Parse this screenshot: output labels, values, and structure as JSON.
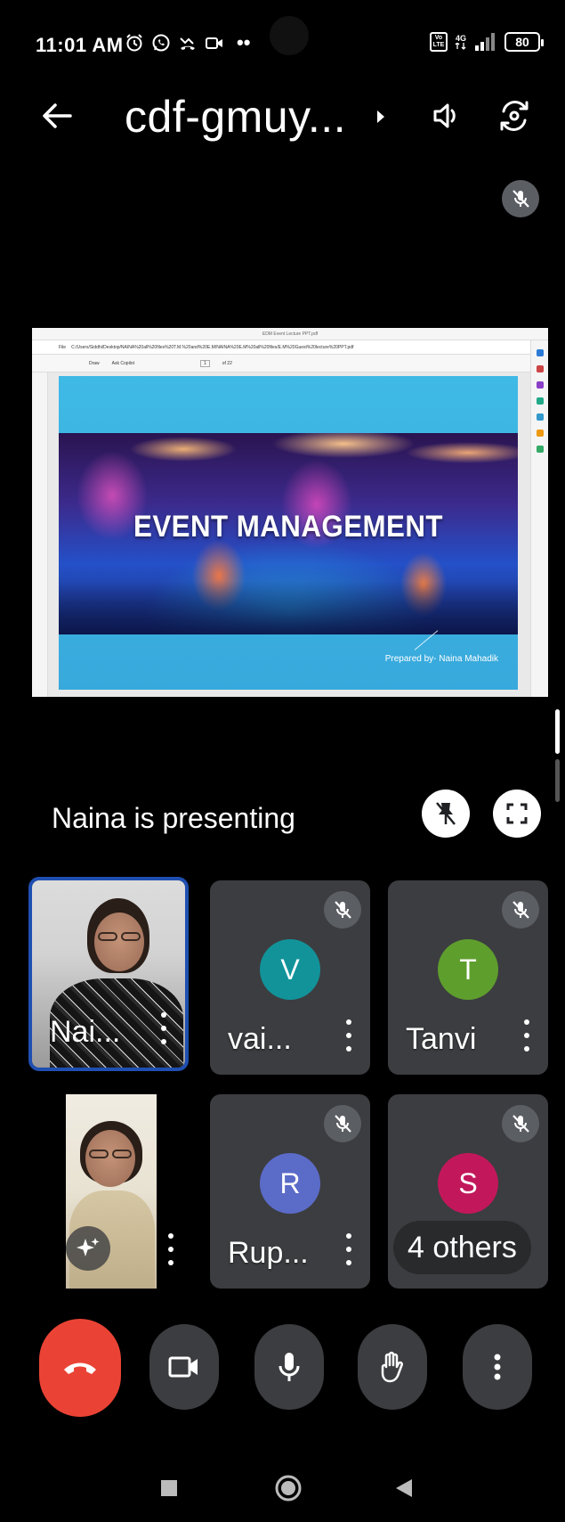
{
  "status_bar": {
    "time": "11:01 AM",
    "dots": "••",
    "volte_top": "Vo",
    "volte_bottom": "LTE",
    "network": "4G",
    "battery": "80"
  },
  "header": {
    "meeting_title": "cdf-gmuy..."
  },
  "presentation": {
    "browser_tab_title": "EDM Event Lecture PPT.pdf",
    "browser_file_label": "File",
    "browser_url": "C:/Users/Siddhi/Desktop/NAINA%20all%20files%20T.M.%20and%20E.M/NAINA%20E.M%20all%20files/E.M%20Guest%20lecture%20PPT.pdf",
    "toolbar_draw": "Draw",
    "toolbar_ask": "Ask Copilot",
    "toolbar_page": "1",
    "toolbar_of": "of 22",
    "slide_title": "EVENT MANAGEMENT",
    "slide_credit": "Prepared by- Naina Mahadik",
    "presenting_label": "Naina is presenting"
  },
  "participants": [
    {
      "name": "Nai...",
      "initial": "",
      "avatar_color": ""
    },
    {
      "name": "vai...",
      "initial": "V",
      "avatar_color": "#12939a"
    },
    {
      "name": "Tanvi",
      "initial": "T",
      "avatar_color": "#5e9e2d"
    },
    {
      "name": "",
      "initial": "",
      "avatar_color": ""
    },
    {
      "name": "Rup...",
      "initial": "R",
      "avatar_color": "#5b6bc8"
    },
    {
      "name": "",
      "initial": "S",
      "avatar_color": "#c2185b"
    }
  ],
  "others_chip": "4 others",
  "colors": {
    "end_call": "#ea4335",
    "active_speaker_border": "#1f4fb0",
    "tile_bg": "#3c3d40"
  }
}
